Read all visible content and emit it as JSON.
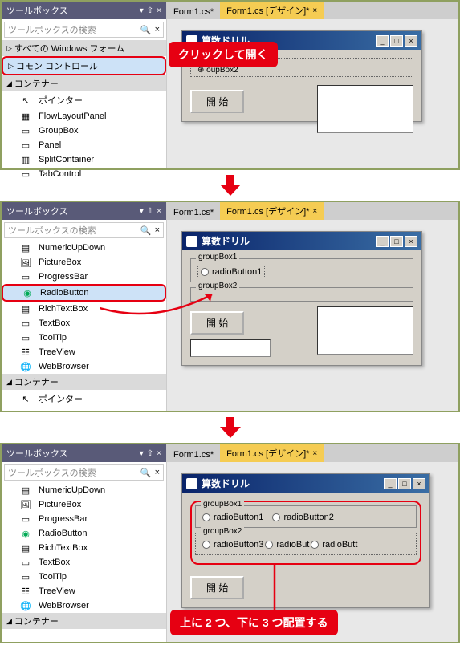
{
  "toolbox": {
    "title": "ツールボックス",
    "search_placeholder": "ツールボックスの検索",
    "panel1": {
      "header1": "すべての Windows フォーム",
      "header2": "コモン コントロール",
      "header3": "コンテナー",
      "items": [
        "ポインター",
        "FlowLayoutPanel",
        "GroupBox",
        "Panel",
        "SplitContainer",
        "TabControl"
      ]
    },
    "panel2": {
      "items": [
        "NumericUpDown",
        "PictureBox",
        "ProgressBar",
        "RadioButton",
        "RichTextBox",
        "TextBox",
        "ToolTip",
        "TreeView",
        "WebBrowser"
      ],
      "header_container": "コンテナー",
      "pointer": "ポインター"
    },
    "panel3": {
      "items": [
        "NumericUpDown",
        "PictureBox",
        "ProgressBar",
        "RadioButton",
        "RichTextBox",
        "TextBox",
        "ToolTip",
        "TreeView",
        "WebBrowser"
      ],
      "header_container": "コンテナー"
    }
  },
  "tabs": {
    "tab1": "Form1.cs*",
    "tab2": "Form1.cs [デザイン]*"
  },
  "form": {
    "title": "算数ドリル",
    "groupbox1": "groupBox1",
    "groupbox2": "groupBox2",
    "partial_label": "oupBox2",
    "radio1": "radioButton1",
    "radio2": "radioButton2",
    "radio3_trunc": "radioButton3",
    "radio4_trunc": "radioBut",
    "radio5_trunc": "radioButt",
    "start_btn": "開 始"
  },
  "callouts": {
    "c1": "クリックして開く",
    "c2": "上に 2 つ、下に 3 つ配置する"
  }
}
